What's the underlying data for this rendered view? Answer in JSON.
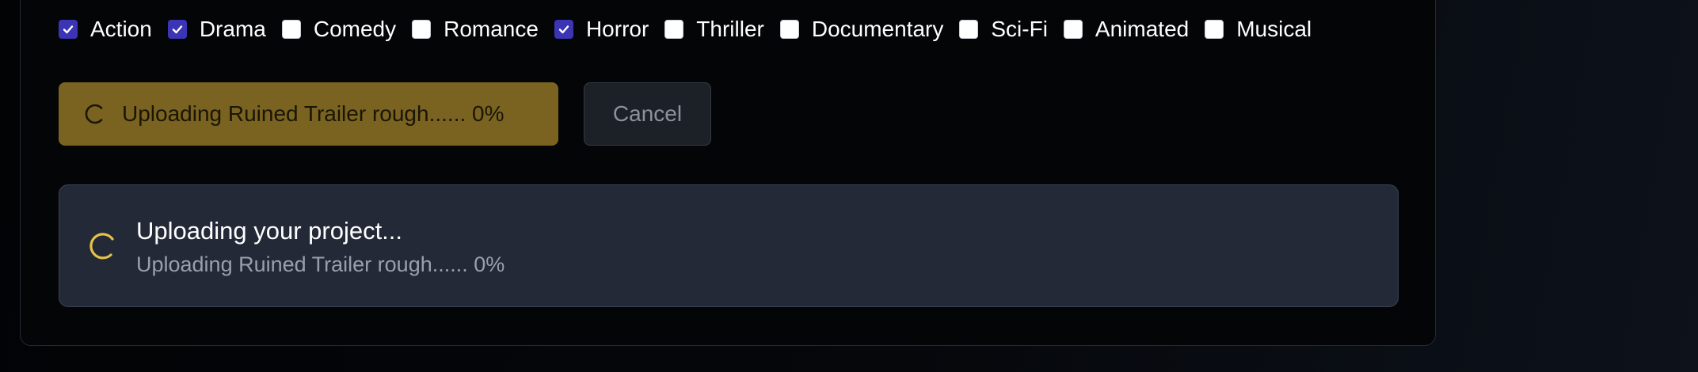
{
  "genres": [
    {
      "label": "Action",
      "checked": true
    },
    {
      "label": "Drama",
      "checked": true
    },
    {
      "label": "Comedy",
      "checked": false
    },
    {
      "label": "Romance",
      "checked": false
    },
    {
      "label": "Horror",
      "checked": true
    },
    {
      "label": "Thriller",
      "checked": false
    },
    {
      "label": "Documentary",
      "checked": false
    },
    {
      "label": "Sci-Fi",
      "checked": false
    },
    {
      "label": "Animated",
      "checked": false
    },
    {
      "label": "Musical",
      "checked": false
    }
  ],
  "upload_button": {
    "label": "Uploading Ruined Trailer rough...... 0%",
    "icon": "spinner-icon"
  },
  "cancel_button": {
    "label": "Cancel"
  },
  "status": {
    "title": "Uploading your project...",
    "subtitle": "Uploading Ruined Trailer rough...... 0%",
    "icon": "spinner-icon",
    "progress_percent": 0
  },
  "colors": {
    "checkbox_checked": "#3b35b5",
    "upload_button_bg": "#7a6320",
    "spinner_accent": "#e6c24a",
    "panel_bg": "#232936"
  }
}
